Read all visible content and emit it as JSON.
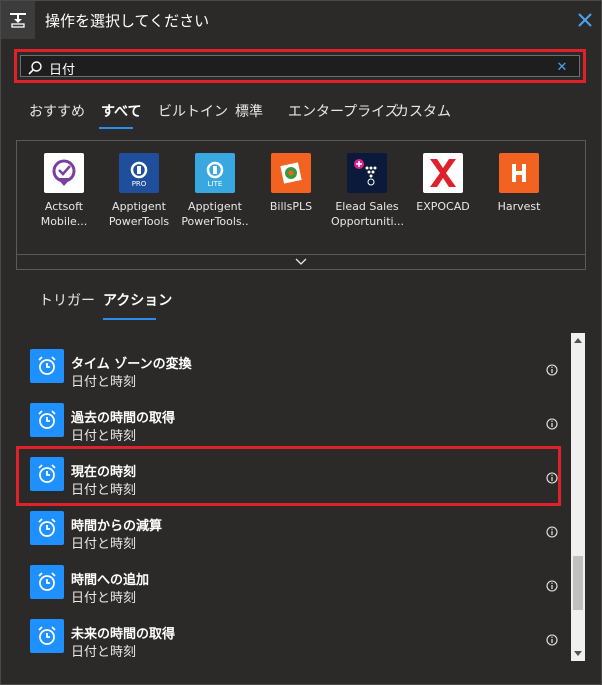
{
  "header": {
    "title": "操作を選択してください",
    "icon": "flow-step-icon",
    "close_icon": "close-icon"
  },
  "search": {
    "value": "日付",
    "placeholder": ""
  },
  "tabs": [
    {
      "label": "おすすめ",
      "active": false
    },
    {
      "label": "すべて",
      "active": true
    },
    {
      "label": "ビルトイン",
      "active": false
    },
    {
      "label": "標準",
      "active": false
    },
    {
      "label": "エンタープライズ",
      "active": false
    },
    {
      "label": "カスタム",
      "active": false
    }
  ],
  "connectors": [
    {
      "label": "Actsoft Mobile...",
      "color": "#ffffff"
    },
    {
      "label": "Apptigent PowerTools",
      "color": "#1f4e9c"
    },
    {
      "label": "Apptigent PowerTools..",
      "color": "#3aa8e0"
    },
    {
      "label": "BillsPLS",
      "color": "#f26322"
    },
    {
      "label": "Elead Sales Opportuniti...",
      "color": "#0b1a3a"
    },
    {
      "label": "EXPOCAD",
      "color": "#ffffff"
    },
    {
      "label": "Harvest",
      "color": "#f26322"
    }
  ],
  "subtabs": [
    {
      "label": "トリガー",
      "active": false
    },
    {
      "label": "アクション",
      "active": true
    }
  ],
  "actions": [
    {
      "title": "タイム ゾーンの変換",
      "subtitle": "日付と時刻"
    },
    {
      "title": "過去の時間の取得",
      "subtitle": "日付と時刻"
    },
    {
      "title": "現在の時刻",
      "subtitle": "日付と時刻"
    },
    {
      "title": "時間からの減算",
      "subtitle": "日付と時刻"
    },
    {
      "title": "時間への追加",
      "subtitle": "日付と時刻"
    },
    {
      "title": "未来の時間の取得",
      "subtitle": "日付と時刻"
    }
  ],
  "colors": {
    "accent": "#2d8ceb",
    "highlight": "#e0202a",
    "action_icon_bg": "#1e90ff"
  },
  "scroll": {
    "position": 0.85,
    "visible_fraction": 0.18
  }
}
